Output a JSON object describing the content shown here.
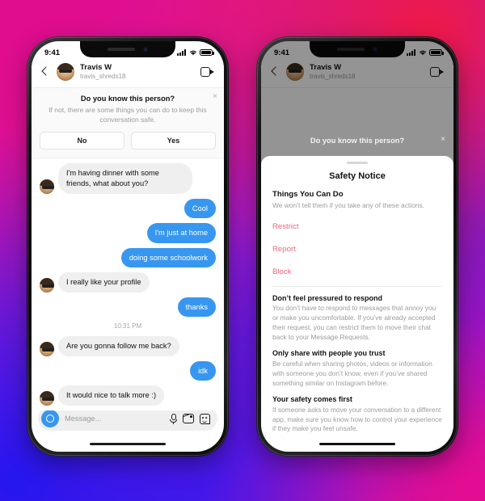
{
  "background": {
    "gradient_colors": [
      "#e00d8e",
      "#f01948",
      "#9b1ad0",
      "#2516ef",
      "#df0f90"
    ]
  },
  "theme": {
    "instagram_blue": "#3797f0",
    "action_red": "#f2657a",
    "incoming_bubble": "#efefef",
    "muted_text": "#9c9c9c"
  },
  "status_bar": {
    "time": "9:41",
    "signal_icon": "cellular-bars-icon",
    "wifi_icon": "wifi-icon",
    "battery_icon": "battery-icon"
  },
  "chat_header": {
    "back_icon": "back-chevron-icon",
    "avatar_icon": "profile-avatar",
    "name": "Travis W",
    "handle": "travis_shreds18",
    "video_icon": "video-call-icon"
  },
  "know_person_banner": {
    "title": "Do you know this person?",
    "subtitle": "If not, there are some things you can do to keep this conversation safe.",
    "close_icon": "close-icon",
    "close_glyph": "×",
    "no_label": "No",
    "yes_label": "Yes"
  },
  "conversation": {
    "messages": [
      {
        "direction": "in",
        "text": "I'm having dinner with some friends, what about you?",
        "avatar": true
      },
      {
        "direction": "out",
        "text": "Cool"
      },
      {
        "direction": "out",
        "text": "I'm just at home"
      },
      {
        "direction": "out",
        "text": "doing some schoolwork"
      },
      {
        "direction": "in",
        "text": "I really like your profile",
        "avatar": true
      },
      {
        "direction": "out",
        "text": "thanks"
      }
    ],
    "timestamp": "10:31 PM",
    "messages_after": [
      {
        "direction": "in",
        "text": "Are you gonna follow me back?",
        "avatar": true
      },
      {
        "direction": "out",
        "text": "idk"
      },
      {
        "direction": "in",
        "text": "It would nice to talk more :)",
        "avatar": true
      }
    ]
  },
  "composer": {
    "camera_icon": "camera-icon",
    "placeholder": "Message...",
    "mic_icon": "microphone-icon",
    "image_icon": "image-icon",
    "sticker_icon": "sticker-icon"
  },
  "safety_sheet": {
    "grabber_icon": "sheet-grabber",
    "title": "Safety Notice",
    "section_heading": "Things You Can Do",
    "section_subtext": "We won’t tell them if you take any of these actions.",
    "actions": [
      "Restrict",
      "Report",
      "Block"
    ],
    "tips": [
      {
        "heading": "Don’t feel pressured to respond",
        "body": "You don’t have to respond to messages that annoy you or make you uncomfortable. If you’ve already accepted their request, you can restrict them to move their chat back to your Message Requests."
      },
      {
        "heading": "Only share with people you trust",
        "body": "Be careful when sharing photos, videos or information with someone you don’t know, even if you’ve shared something similar on Instagram before."
      },
      {
        "heading": "Your safety comes first",
        "body": "If someone asks to move your conversation to a different app, make sure you know how to control your experience if they make you feel unsafe."
      }
    ]
  }
}
